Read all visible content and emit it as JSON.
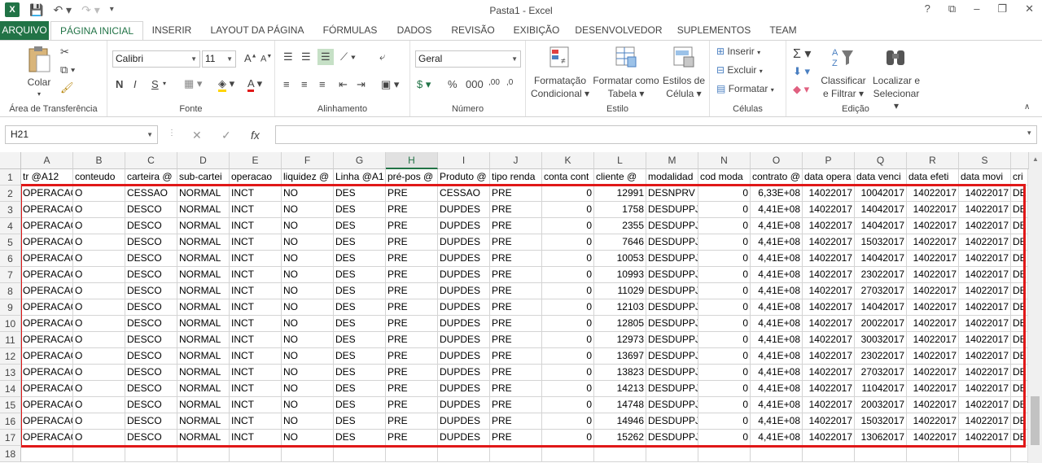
{
  "window": {
    "title": "Pasta1 - Excel",
    "app_logo": "X",
    "controls": [
      "?",
      "⧉",
      "–",
      "❐",
      "✕"
    ]
  },
  "tabs": [
    "ARQUIVO",
    "PÁGINA INICIAL",
    "INSERIR",
    "LAYOUT DA PÁGINA",
    "FÓRMULAS",
    "DADOS",
    "REVISÃO",
    "EXIBIÇÃO",
    "DESENVOLVEDOR",
    "SUPLEMENTOS",
    "TEAM"
  ],
  "ribbon": {
    "clipboard": {
      "label": "Área de Transferência",
      "paste": "Colar"
    },
    "font": {
      "label": "Fonte",
      "name": "Calibri",
      "size": "11",
      "bold": "N",
      "italic": "I",
      "underline": "S"
    },
    "alignment": {
      "label": "Alinhamento"
    },
    "number": {
      "label": "Número",
      "format": "Geral"
    },
    "styles": {
      "label": "Estilo",
      "conditional": "Formatação\nCondicional",
      "conditional_l1": "Formatação",
      "conditional_l2": "Condicional ▾",
      "table_l1": "Formatar como",
      "table_l2": "Tabela ▾",
      "cell_l1": "Estilos de",
      "cell_l2": "Célula ▾"
    },
    "cells": {
      "label": "Células",
      "insert": "Inserir",
      "delete": "Excluir",
      "format": "Formatar"
    },
    "editing": {
      "label": "Edição",
      "sort_l1": "Classificar",
      "sort_l2": "e Filtrar ▾",
      "find_l1": "Localizar e",
      "find_l2": "Selecionar ▾"
    }
  },
  "formula_bar": {
    "name_box": "H21",
    "fx": "fx",
    "value": ""
  },
  "sheet": {
    "columns": [
      "A",
      "B",
      "C",
      "D",
      "E",
      "F",
      "G",
      "H",
      "I",
      "J",
      "K",
      "L",
      "M",
      "N",
      "O",
      "P",
      "Q",
      "R",
      "S",
      ""
    ],
    "selected_column": "H",
    "row_numbers": [
      "1",
      "2",
      "3",
      "4",
      "5",
      "6",
      "7",
      "8",
      "9",
      "10",
      "11",
      "12",
      "13",
      "14",
      "15",
      "16",
      "17",
      "18"
    ],
    "header_row": [
      "tr @A12",
      "conteudo",
      "carteira @",
      "sub-cartei",
      "operacao",
      "liquidez @",
      "Linha @A1",
      "pré-pos @",
      "Produto @",
      "tipo renda",
      "conta cont",
      "cliente @",
      "modalidad",
      "cod moda",
      "contrato @",
      "data opera",
      "data venci",
      "data efeti",
      "data movi",
      "cri"
    ],
    "rows": [
      [
        "OPERACAO",
        "O",
        "CESSAO",
        "NORMAL",
        "INCT",
        "NO",
        "DES",
        "PRE",
        "CESSAO",
        "PRE",
        "0",
        "12991",
        "DESNPRV",
        "0",
        "6,33E+08",
        "14022017",
        "10042017",
        "14022017",
        "14022017",
        "DE"
      ],
      [
        "OPERACAO",
        "O",
        "DESCO",
        "NORMAL",
        "INCT",
        "NO",
        "DES",
        "PRE",
        "DUPDES",
        "PRE",
        "0",
        "1758",
        "DESDUPPJ",
        "0",
        "4,41E+08",
        "14022017",
        "14042017",
        "14022017",
        "14022017",
        "DE"
      ],
      [
        "OPERACAO",
        "O",
        "DESCO",
        "NORMAL",
        "INCT",
        "NO",
        "DES",
        "PRE",
        "DUPDES",
        "PRE",
        "0",
        "2355",
        "DESDUPPJ",
        "0",
        "4,41E+08",
        "14022017",
        "14042017",
        "14022017",
        "14022017",
        "DE"
      ],
      [
        "OPERACAO",
        "O",
        "DESCO",
        "NORMAL",
        "INCT",
        "NO",
        "DES",
        "PRE",
        "DUPDES",
        "PRE",
        "0",
        "7646",
        "DESDUPPJ",
        "0",
        "4,41E+08",
        "14022017",
        "15032017",
        "14022017",
        "14022017",
        "DE"
      ],
      [
        "OPERACAO",
        "O",
        "DESCO",
        "NORMAL",
        "INCT",
        "NO",
        "DES",
        "PRE",
        "DUPDES",
        "PRE",
        "0",
        "10053",
        "DESDUPPJ",
        "0",
        "4,41E+08",
        "14022017",
        "14042017",
        "14022017",
        "14022017",
        "DE"
      ],
      [
        "OPERACAO",
        "O",
        "DESCO",
        "NORMAL",
        "INCT",
        "NO",
        "DES",
        "PRE",
        "DUPDES",
        "PRE",
        "0",
        "10993",
        "DESDUPPJ",
        "0",
        "4,41E+08",
        "14022017",
        "23022017",
        "14022017",
        "14022017",
        "DE"
      ],
      [
        "OPERACAO",
        "O",
        "DESCO",
        "NORMAL",
        "INCT",
        "NO",
        "DES",
        "PRE",
        "DUPDES",
        "PRE",
        "0",
        "11029",
        "DESDUPPJ",
        "0",
        "4,41E+08",
        "14022017",
        "27032017",
        "14022017",
        "14022017",
        "DE"
      ],
      [
        "OPERACAO",
        "O",
        "DESCO",
        "NORMAL",
        "INCT",
        "NO",
        "DES",
        "PRE",
        "DUPDES",
        "PRE",
        "0",
        "12103",
        "DESDUPPJ",
        "0",
        "4,41E+08",
        "14022017",
        "14042017",
        "14022017",
        "14022017",
        "DE"
      ],
      [
        "OPERACAO",
        "O",
        "DESCO",
        "NORMAL",
        "INCT",
        "NO",
        "DES",
        "PRE",
        "DUPDES",
        "PRE",
        "0",
        "12805",
        "DESDUPPJ",
        "0",
        "4,41E+08",
        "14022017",
        "20022017",
        "14022017",
        "14022017",
        "DE"
      ],
      [
        "OPERACAO",
        "O",
        "DESCO",
        "NORMAL",
        "INCT",
        "NO",
        "DES",
        "PRE",
        "DUPDES",
        "PRE",
        "0",
        "12973",
        "DESDUPPJ",
        "0",
        "4,41E+08",
        "14022017",
        "30032017",
        "14022017",
        "14022017",
        "DE"
      ],
      [
        "OPERACAO",
        "O",
        "DESCO",
        "NORMAL",
        "INCT",
        "NO",
        "DES",
        "PRE",
        "DUPDES",
        "PRE",
        "0",
        "13697",
        "DESDUPPJ",
        "0",
        "4,41E+08",
        "14022017",
        "23022017",
        "14022017",
        "14022017",
        "DE"
      ],
      [
        "OPERACAO",
        "O",
        "DESCO",
        "NORMAL",
        "INCT",
        "NO",
        "DES",
        "PRE",
        "DUPDES",
        "PRE",
        "0",
        "13823",
        "DESDUPPJ",
        "0",
        "4,41E+08",
        "14022017",
        "27032017",
        "14022017",
        "14022017",
        "DE"
      ],
      [
        "OPERACAO",
        "O",
        "DESCO",
        "NORMAL",
        "INCT",
        "NO",
        "DES",
        "PRE",
        "DUPDES",
        "PRE",
        "0",
        "14213",
        "DESDUPPJ",
        "0",
        "4,41E+08",
        "14022017",
        "11042017",
        "14022017",
        "14022017",
        "DE"
      ],
      [
        "OPERACAO",
        "O",
        "DESCO",
        "NORMAL",
        "INCT",
        "NO",
        "DES",
        "PRE",
        "DUPDES",
        "PRE",
        "0",
        "14748",
        "DESDUPPJ",
        "0",
        "4,41E+08",
        "14022017",
        "20032017",
        "14022017",
        "14022017",
        "DE"
      ],
      [
        "OPERACAO",
        "O",
        "DESCO",
        "NORMAL",
        "INCT",
        "NO",
        "DES",
        "PRE",
        "DUPDES",
        "PRE",
        "0",
        "14946",
        "DESDUPPJ",
        "0",
        "4,41E+08",
        "14022017",
        "15032017",
        "14022017",
        "14022017",
        "DE"
      ],
      [
        "OPERACAO",
        "O",
        "DESCO",
        "NORMAL",
        "INCT",
        "NO",
        "DES",
        "PRE",
        "DUPDES",
        "PRE",
        "0",
        "15262",
        "DESDUPPJ",
        "0",
        "4,41E+08",
        "14022017",
        "13062017",
        "14022017",
        "14022017",
        "DE"
      ]
    ],
    "numeric_columns": [
      10,
      11,
      13,
      14,
      15,
      16,
      17,
      18
    ]
  },
  "colors": {
    "accent": "#217346",
    "highlight_border": "#e01818"
  }
}
